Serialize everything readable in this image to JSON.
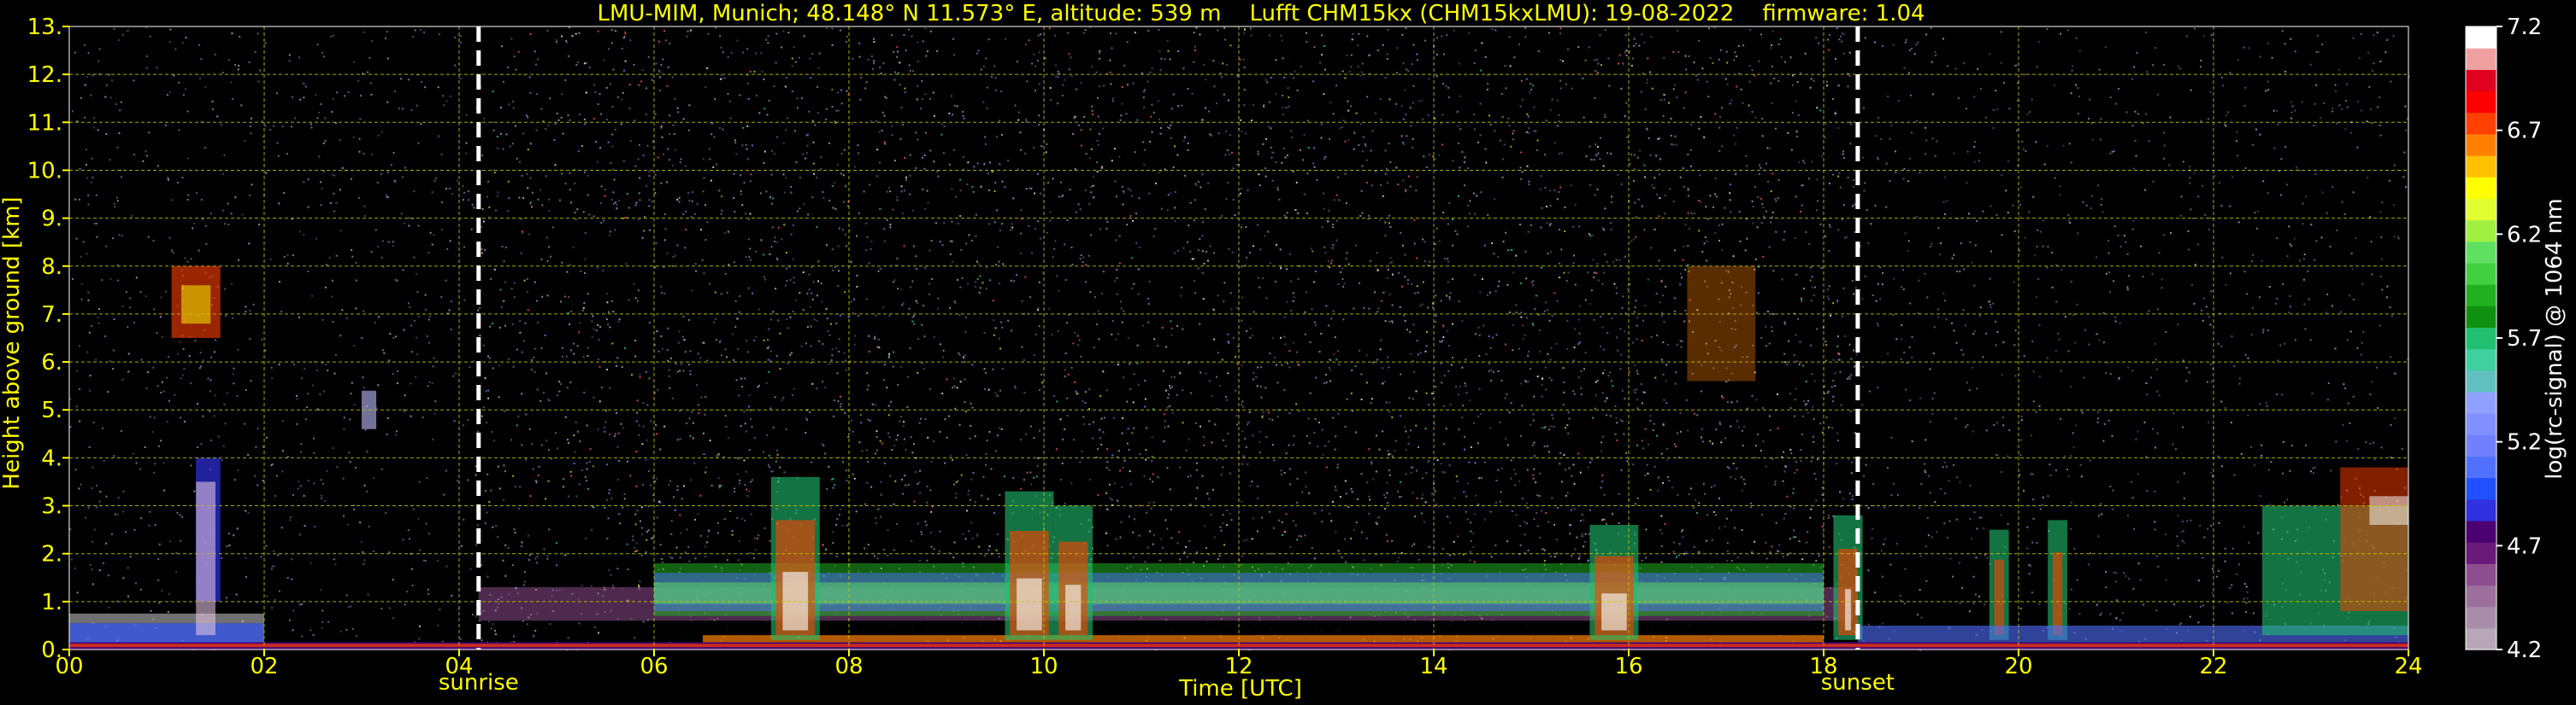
{
  "chart_data": {
    "type": "heatmap",
    "title": "LMU-MIM, Munich; 48.148° N 11.573° E, altitude: 539 m    Lufft CHM15kx (CHM15kxLMU): 19-08-2022    firmware: 1.04",
    "xlabel": "Time [UTC]",
    "ylabel": "Height above ground [km]",
    "xlim": [
      0,
      24
    ],
    "ylim": [
      0,
      13
    ],
    "x_ticks": [
      0,
      2,
      4,
      6,
      8,
      10,
      12,
      14,
      16,
      18,
      20,
      22,
      24
    ],
    "x_tick_labels": [
      "00",
      "02",
      "04",
      "06",
      "08",
      "10",
      "12",
      "14",
      "16",
      "18",
      "20",
      "22",
      "24"
    ],
    "y_ticks": [
      0,
      1,
      2,
      3,
      4,
      5,
      6,
      7,
      8,
      9,
      10,
      11,
      12,
      13
    ],
    "y_tick_labels": [
      "0.",
      "1.",
      "2.",
      "3.",
      "4.",
      "5.",
      "6.",
      "7.",
      "8.",
      "9.",
      "10.",
      "11.",
      "12.",
      "13."
    ],
    "grid": true,
    "events": [
      {
        "name": "sunrise",
        "time": 4.2
      },
      {
        "name": "sunset",
        "time": 18.35
      }
    ],
    "colorbar": {
      "label": "log(rc-signal) @ 1064 nm",
      "range": [
        4.2,
        7.2
      ],
      "ticks": [
        4.2,
        4.7,
        5.2,
        5.7,
        6.2,
        6.7,
        7.2
      ],
      "tick_labels": [
        "4.2",
        "4.7",
        "5.2",
        "5.7",
        "6.2",
        "6.7",
        "7.2"
      ],
      "colors": [
        "#b8a7b8",
        "#a88ea8",
        "#9c6f9c",
        "#8e4d8e",
        "#6a1a7a",
        "#4a0070",
        "#3030e0",
        "#2050ff",
        "#5070ff",
        "#7080ff",
        "#8090ff",
        "#90a0ff",
        "#60c0c0",
        "#40d0a0",
        "#20c070",
        "#109010",
        "#20b020",
        "#40d040",
        "#60e060",
        "#a0f040",
        "#e0ff30",
        "#ffff00",
        "#ffc000",
        "#ff8000",
        "#ff4000",
        "#ff0000",
        "#e00020",
        "#f0a0a0",
        "#ffffff"
      ]
    }
  }
}
